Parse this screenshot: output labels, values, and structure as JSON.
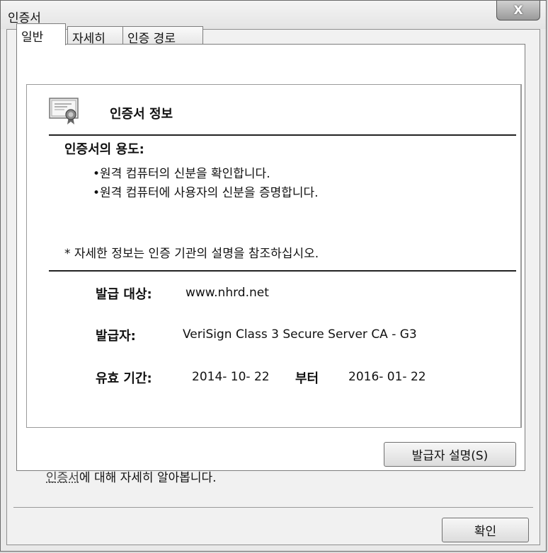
{
  "window": {
    "title": "인증서",
    "close_glyph": "X"
  },
  "tabs": [
    {
      "label": "일반",
      "active": true
    },
    {
      "label": "자세히",
      "active": false
    },
    {
      "label": "인증 경로",
      "active": false
    }
  ],
  "info": {
    "section_title": "인증서 정보",
    "purpose_heading": "인증서의 용도:",
    "purposes": [
      "•원격 컴퓨터의 신분을 확인합니다.",
      "•원격 컴퓨터에 사용자의 신분을 증명합니다."
    ],
    "footnote": "* 자세한 정보는 인증 기관의 설명을 참조하십시오.",
    "issued_to_label": "발급 대상:",
    "issued_to_value": "www.nhrd.net",
    "issuer_label": "발급자:",
    "issuer_value": "VeriSign Class 3 Secure Server CA - G3",
    "validity_label": "유효 기간:",
    "valid_from": "2014- 10- 22",
    "validity_sep": "부터",
    "valid_to": "2016- 01- 22"
  },
  "buttons": {
    "issuer_statement": "발급자 설명(S)",
    "ok": "확인"
  },
  "learn_more": {
    "link": "인증서",
    "rest": "에 대해 자세히 알아봅니다."
  },
  "colors": {
    "border": "#7d7d7d",
    "text": "#111111",
    "panel": "#ffffff"
  },
  "icons": {
    "certificate": "certificate-icon",
    "close": "close-icon"
  }
}
